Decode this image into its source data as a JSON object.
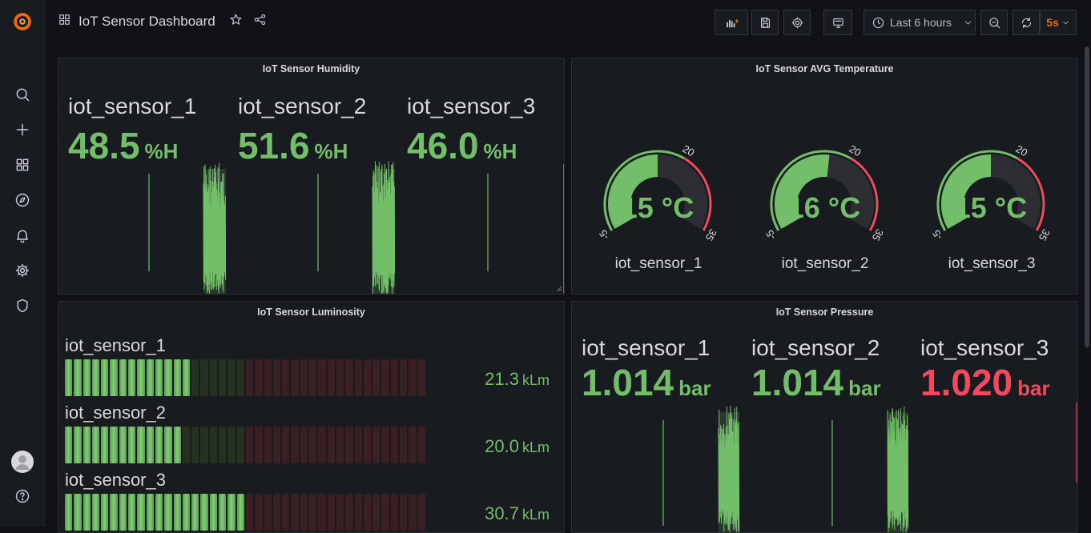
{
  "dashboard": {
    "title": "IoT Sensor Dashboard",
    "time_range": "Last 6 hours",
    "refresh_interval": "5s"
  },
  "colors": {
    "green": "#73bf69",
    "red": "#f2495c",
    "orange_logo": "#f46800",
    "panel_bg": "#181b1f",
    "page_bg": "#111217"
  },
  "sidebar": {
    "icons": [
      "grafana-logo-icon",
      "search-icon",
      "plus-icon",
      "dashboards-icon",
      "explore-icon",
      "alerting-icon",
      "settings-icon",
      "shield-icon",
      "avatar",
      "help-icon"
    ]
  },
  "panels": {
    "humidity": {
      "title": "IoT Sensor Humidity",
      "stats": [
        {
          "name": "iot_sensor_1",
          "value": "48.5",
          "unit": "%H",
          "color": "#73bf69"
        },
        {
          "name": "iot_sensor_2",
          "value": "51.6",
          "unit": "%H",
          "color": "#73bf69"
        },
        {
          "name": "iot_sensor_3",
          "value": "46.0",
          "unit": "%H",
          "color": "#73bf69"
        }
      ]
    },
    "temperature": {
      "title": "IoT Sensor AVG Temperature",
      "gauge_min": "-5",
      "gauge_threshold": "20",
      "gauge_max": "35",
      "gauges": [
        {
          "name": "iot_sensor_1",
          "value": 15,
          "label": "15 °C"
        },
        {
          "name": "iot_sensor_2",
          "value": 16,
          "label": "16 °C"
        },
        {
          "name": "iot_sensor_3",
          "value": 15,
          "label": "15 °C"
        }
      ]
    },
    "luminosity": {
      "title": "IoT Sensor Luminosity",
      "bars": [
        {
          "name": "iot_sensor_1",
          "value": "21.3",
          "unit": "kLm",
          "fraction": 0.34
        },
        {
          "name": "iot_sensor_2",
          "value": "20.0",
          "unit": "kLm",
          "fraction": 0.32
        },
        {
          "name": "iot_sensor_3",
          "value": "30.7",
          "unit": "kLm",
          "fraction": 0.49
        }
      ]
    },
    "pressure": {
      "title": "IoT Sensor Pressure",
      "stats": [
        {
          "name": "iot_sensor_1",
          "value": "1.014",
          "unit": "bar",
          "color": "#73bf69"
        },
        {
          "name": "iot_sensor_2",
          "value": "1.014",
          "unit": "bar",
          "color": "#73bf69"
        },
        {
          "name": "iot_sensor_3",
          "value": "1.020",
          "unit": "bar",
          "color": "#f2495c"
        }
      ]
    }
  }
}
